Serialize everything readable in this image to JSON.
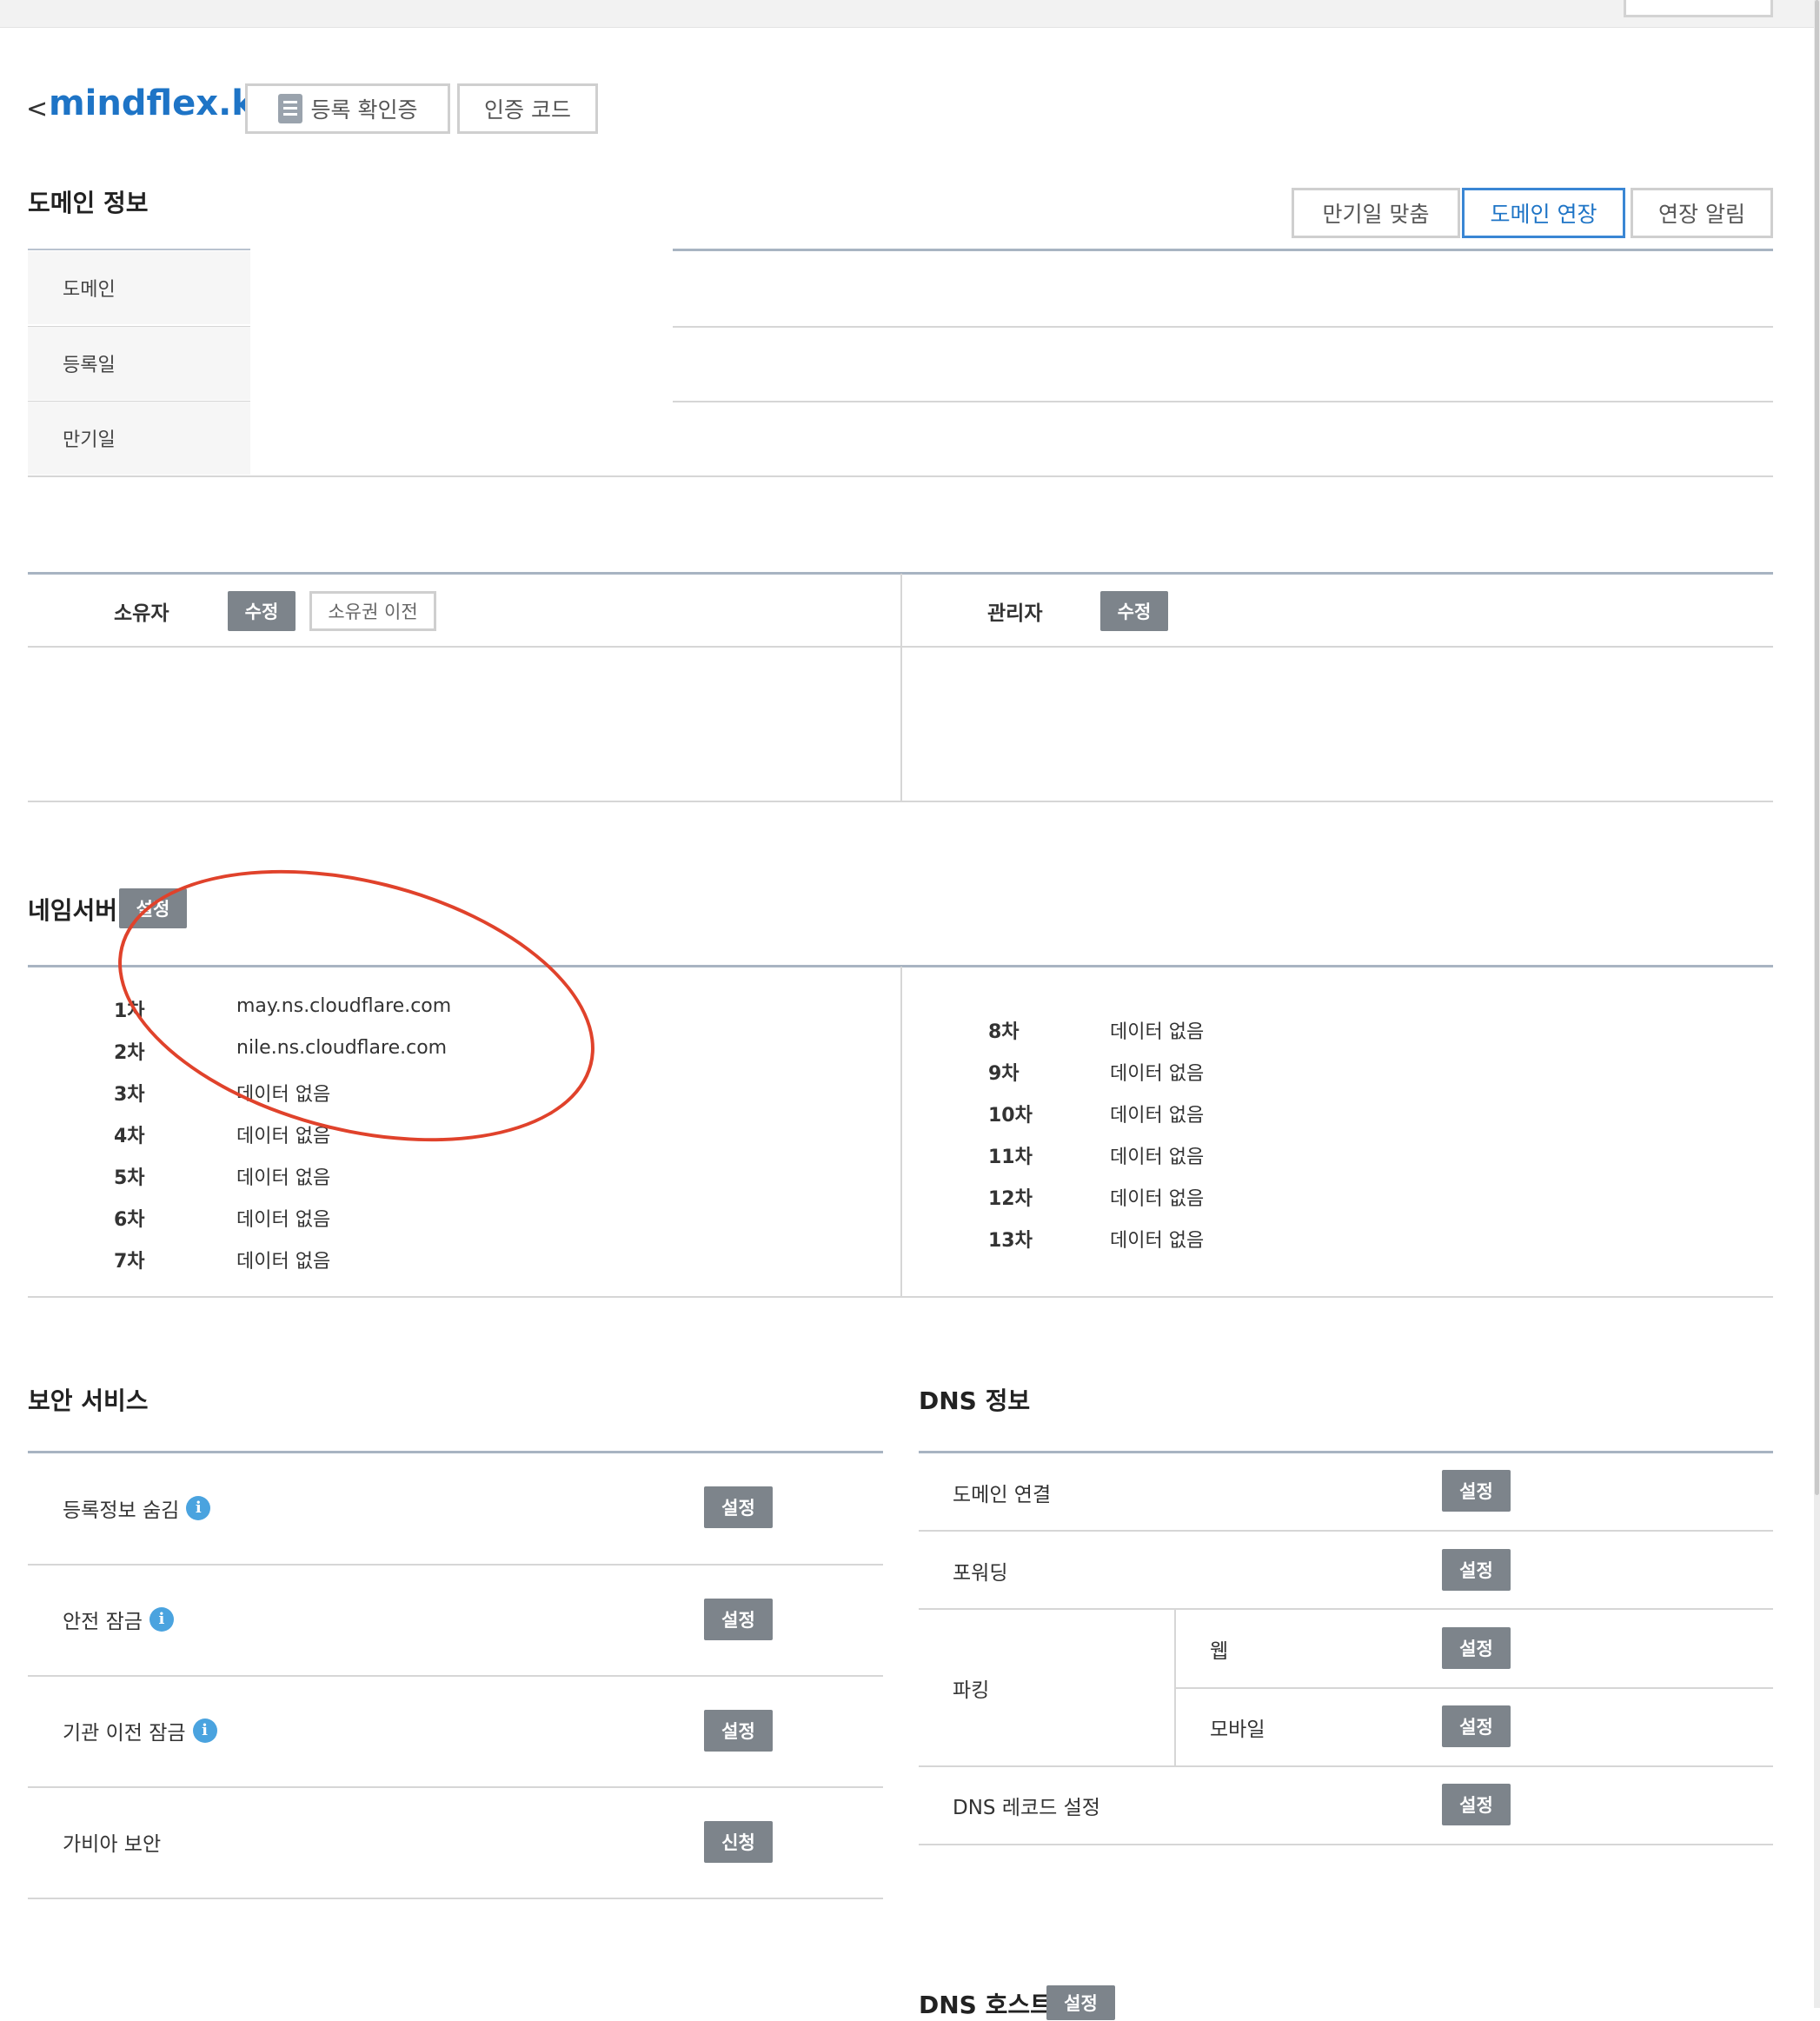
{
  "header": {
    "back_symbol": "<",
    "domain": "mindflex.kr",
    "cert_button": "등록 확인증",
    "auth_code_button": "인증 코드"
  },
  "domain_info": {
    "title": "도메인 정보",
    "actions": {
      "match_expiry": "만기일 맞춤",
      "extend": "도메인 연장",
      "renew_alert": "연장 알림"
    },
    "rows": [
      {
        "label": "도메인",
        "value": ""
      },
      {
        "label": "등록일",
        "value": ""
      },
      {
        "label": "만기일",
        "value": ""
      }
    ]
  },
  "contacts": {
    "owner_label": "소유자",
    "owner_edit": "수정",
    "owner_transfer": "소유권 이전",
    "admin_label": "관리자",
    "admin_edit": "수정"
  },
  "nameservers": {
    "title": "네임서버",
    "set_button": "설정",
    "left": [
      {
        "num": "1차",
        "value": "may.ns.cloudflare.com"
      },
      {
        "num": "2차",
        "value": "nile.ns.cloudflare.com"
      },
      {
        "num": "3차",
        "value": "데이터 없음"
      },
      {
        "num": "4차",
        "value": "데이터 없음"
      },
      {
        "num": "5차",
        "value": "데이터 없음"
      },
      {
        "num": "6차",
        "value": "데이터 없음"
      },
      {
        "num": "7차",
        "value": "데이터 없음"
      }
    ],
    "right": [
      {
        "num": "8차",
        "value": "데이터 없음"
      },
      {
        "num": "9차",
        "value": "데이터 없음"
      },
      {
        "num": "10차",
        "value": "데이터 없음"
      },
      {
        "num": "11차",
        "value": "데이터 없음"
      },
      {
        "num": "12차",
        "value": "데이터 없음"
      },
      {
        "num": "13차",
        "value": "데이터 없음"
      }
    ]
  },
  "security": {
    "title": "보안 서비스",
    "items": [
      {
        "label": "등록정보 숨김",
        "button": "설정",
        "info_icon": "i"
      },
      {
        "label": "안전 잠금",
        "button": "설정",
        "info_icon": "i"
      },
      {
        "label": "기관 이전 잠금",
        "button": "설정",
        "info_icon": "i"
      },
      {
        "label": "가비아 보안",
        "button": "신청"
      }
    ]
  },
  "dns_info": {
    "title": "DNS 정보",
    "connect_label": "도메인 연결",
    "connect_button": "설정",
    "forwarding_label": "포워딩",
    "forwarding_button": "설정",
    "parking_label": "파킹",
    "parking_web_label": "웹",
    "parking_web_button": "설정",
    "parking_mobile_label": "모바일",
    "parking_mobile_button": "설정",
    "record_label": "DNS 레코드 설정",
    "record_button": "설정"
  },
  "dns_host": {
    "title": "DNS 호스트",
    "button": "설정"
  },
  "annotation": {
    "color": "#e0422b",
    "shape": "ellipse-around-nameservers"
  },
  "colors": {
    "accent": "#1e74c6",
    "gray_button": "#7d848b",
    "info_icon": "#4aa3df"
  }
}
